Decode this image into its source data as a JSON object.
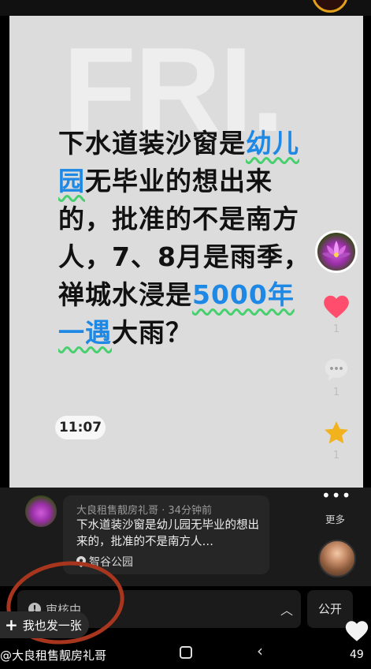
{
  "post": {
    "watermark": "FRI.",
    "headline_segments": [
      {
        "text": "下水道装沙窗是",
        "highlight": false
      },
      {
        "text": "幼儿园",
        "highlight": true
      },
      {
        "text": "无毕业的想出来的，批准的不是南方人，7、8月是雨季，禅城水浸是",
        "highlight": false
      },
      {
        "text": "5000年一遇",
        "highlight": true
      },
      {
        "text": "大雨？",
        "highlight": false
      }
    ],
    "time": "11:07"
  },
  "actions": {
    "like_count": "1",
    "comment_count": "1",
    "favorite_count": "1"
  },
  "caption": {
    "meta": "大良租售靓房礼哥 · 34分钟前",
    "text": "下水道装沙窗是幼儿园无毕业的想出来的，批准的不是南方人…",
    "location": "智谷公园",
    "more_label": "更多"
  },
  "review": {
    "status": "审核中",
    "public_label": "公开"
  },
  "post_pill": {
    "plus": "+",
    "label": "我也发一张"
  },
  "bottom": {
    "handle": "@大良租售靓房礼哥",
    "likes": "49"
  },
  "colors": {
    "highlight_text": "#1e88e5",
    "highlight_underline": "#47d06d",
    "like": "#ff4d6d",
    "star": "#f2b21e"
  },
  "icons": {
    "like": "heart-icon",
    "comment": "comment-icon",
    "favorite": "star-icon",
    "location": "location-pin-icon",
    "warning": "exclamation-icon"
  }
}
